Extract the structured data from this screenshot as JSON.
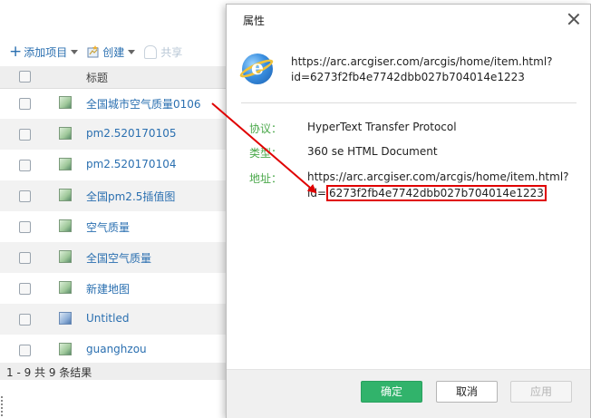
{
  "toolbar": {
    "add_item": "添加项目",
    "create": "创建",
    "share": "共享"
  },
  "list": {
    "header_title": "标题",
    "items": [
      {
        "name": "全国城市空气质量0106",
        "thumb": "map"
      },
      {
        "name": "pm2.520170105",
        "thumb": "map"
      },
      {
        "name": "pm2.520170104",
        "thumb": "map"
      },
      {
        "name": "全国pm2.5插值图",
        "thumb": "map"
      },
      {
        "name": "空气质量",
        "thumb": "map"
      },
      {
        "name": "全国空气质量",
        "thumb": "map"
      },
      {
        "name": "新建地图",
        "thumb": "map"
      },
      {
        "name": "Untitled",
        "thumb": "scene"
      },
      {
        "name": "guanghzou",
        "thumb": "map"
      }
    ],
    "results_text": "1 - 9 共 9 条结果"
  },
  "dialog": {
    "title": "属性",
    "url_line1": "https://arc.arcgiser.com/arcgis/home/item.html?",
    "url_line2": "id=6273f2fb4e7742dbb027b704014e1223",
    "protocol_label": "协议：",
    "protocol_value": "HyperText Transfer Protocol",
    "type_label": "类型：",
    "type_value": "360 se HTML Document",
    "address_label": "地址：",
    "address_line1": "https://arc.arcgiser.com/arcgis/home/item.html?",
    "address_id_prefix": "id=",
    "address_id": "6273f2fb4e7742dbb027b704014e1223",
    "ok": "确定",
    "cancel": "取消",
    "apply": "应用"
  },
  "colors": {
    "link_blue": "#2a6fb0",
    "label_green": "#4aa84a",
    "ok_green": "#31b36b",
    "highlight_red": "#e00000"
  },
  "icons": {
    "dialog_icon": "ie-globe-icon",
    "close": "close-icon"
  }
}
